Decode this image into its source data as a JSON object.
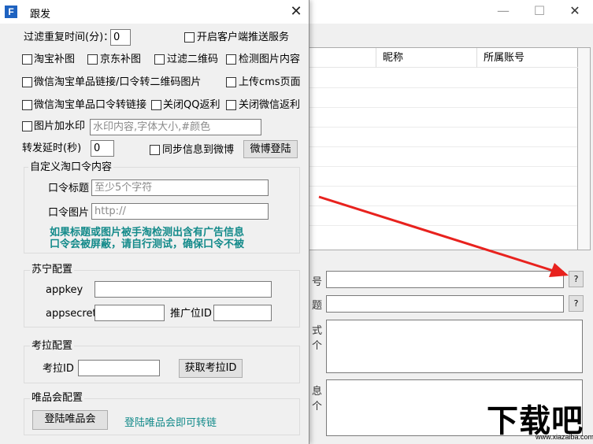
{
  "main_window": {
    "app_icon": "F",
    "minimize_glyph": "—",
    "maximize_glyph": "☐",
    "close_glyph": "✕",
    "grid_headers": [
      "昵称",
      "所属账号"
    ],
    "label_row1": "号",
    "label_row2": "题",
    "label_row3a": "式",
    "label_row3b": "个",
    "label_row4a": "息",
    "label_row4b": "个",
    "help_button": "?"
  },
  "dialog": {
    "icon": "F",
    "title": "跟发",
    "close": "✕",
    "filter_repeat_label": "过滤重复时间(分)：",
    "filter_repeat_value": "0",
    "client_push_label": "开启客户端推送服务",
    "taobao_fill": "淘宝补图",
    "jd_fill": "京东补图",
    "filter_qrcode": "过滤二维码",
    "detect_image": "检测图片内容",
    "wechat_taobao_link": "微信淘宝单品链接/口令转二维码图片",
    "upload_cms": "上传cms页面",
    "wechat_taobao_token": "微信淘宝单品口令转链接",
    "disable_qq_rebate": "关闭QQ返利",
    "disable_wechat_rebate": "关闭微信返利",
    "watermark_label": "图片加水印",
    "watermark_placeholder": "水印内容,字体大小,#颜色",
    "forward_delay_label": "转发延时(秒)",
    "forward_delay_value": "0",
    "sync_weibo_label": "同步信息到微博",
    "weibo_login": "微博登陆",
    "custom_token_group": "自定义淘口令内容",
    "token_title_label": "口令标题",
    "token_title_placeholder": "至少5个字符",
    "token_image_label": "口令图片",
    "token_image_placeholder": "http://",
    "notice_line1": "如果标题或图片被手淘检测出含有广告信息",
    "notice_line2": "口令会被屏蔽，请自行测试，确保口令不被",
    "suning_group": "苏宁配置",
    "appkey_label": "appkey",
    "appsecret_label": "appsecret",
    "promo_id_label": "推广位ID",
    "kaola_group": "考拉配置",
    "kaola_id_label": "考拉ID",
    "get_kaola_id": "获取考拉ID",
    "vip_group": "唯品会配置",
    "vip_login": "登陆唯品会",
    "vip_hint": "登陆唯品会即可转链"
  },
  "watermark": {
    "text": "下载吧",
    "url": "www.xiazaiba.com"
  },
  "colors": {
    "arrow": "#e8221e",
    "notice": "#138a8a",
    "app_icon": "#1e62c0"
  }
}
